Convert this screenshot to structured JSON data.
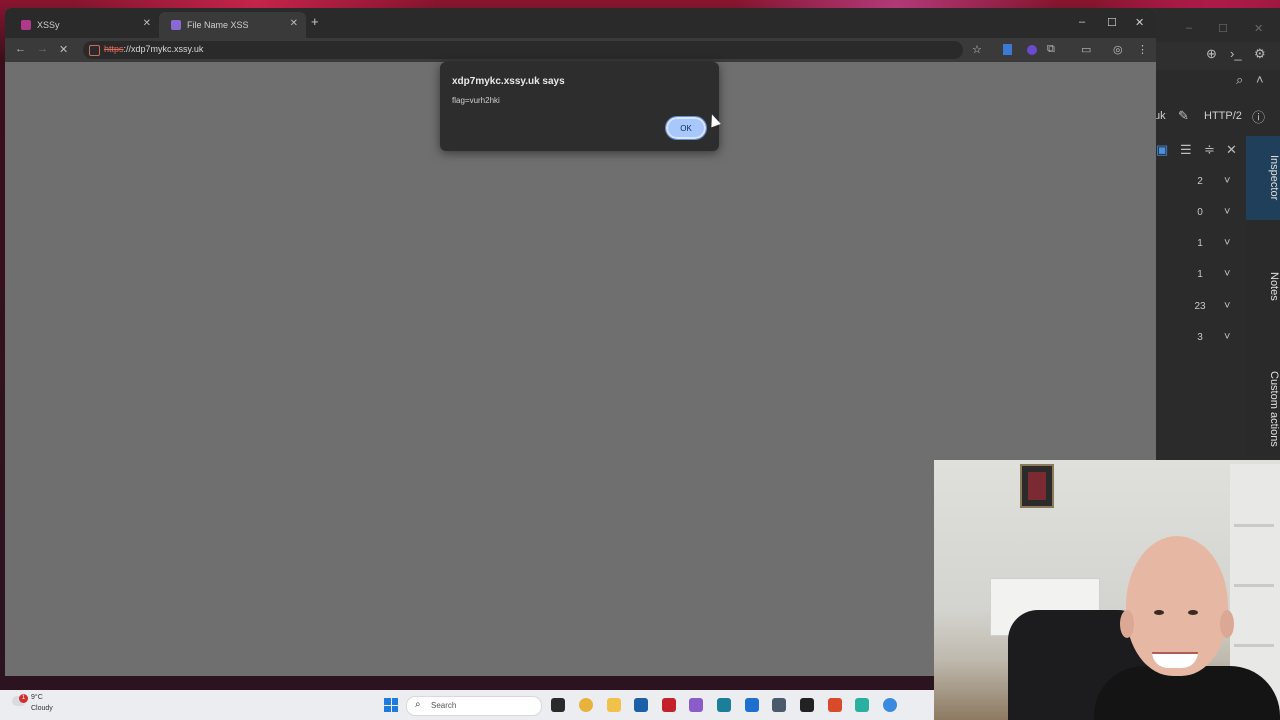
{
  "browser": {
    "tabs": [
      {
        "label": "XSSy",
        "active": false
      },
      {
        "label": "File Name XSS",
        "active": true
      }
    ],
    "new_tab_symbol": "+",
    "window_controls": {
      "minimize": "–",
      "maximize": "☐",
      "close": "✕"
    },
    "address": {
      "scheme": "https",
      "rest": "://xdp7mykc.xssy.uk"
    }
  },
  "dialog": {
    "title": "xdp7mykc.xssy.uk says",
    "message": "flag=vurh2hki",
    "ok_label": "OK"
  },
  "burp": {
    "title_fragment": "uk",
    "protocol": "HTTP/2",
    "counts": [
      "2",
      "0",
      "1",
      "1",
      "23",
      "3"
    ],
    "side_tabs": [
      "Inspector",
      "Notes",
      "Custom actions"
    ]
  },
  "taskbar": {
    "weather_badge": "1",
    "temperature": "9°C",
    "condition": "Cloudy",
    "search_placeholder": "Search"
  },
  "colors": {
    "dialog_bg": "#2d2d2d",
    "ok_button": "#a8c7fa",
    "page_bg": "#6f6f6f",
    "burp_bg": "#2b2b2b",
    "inspector_active": "#1f3f5a"
  }
}
